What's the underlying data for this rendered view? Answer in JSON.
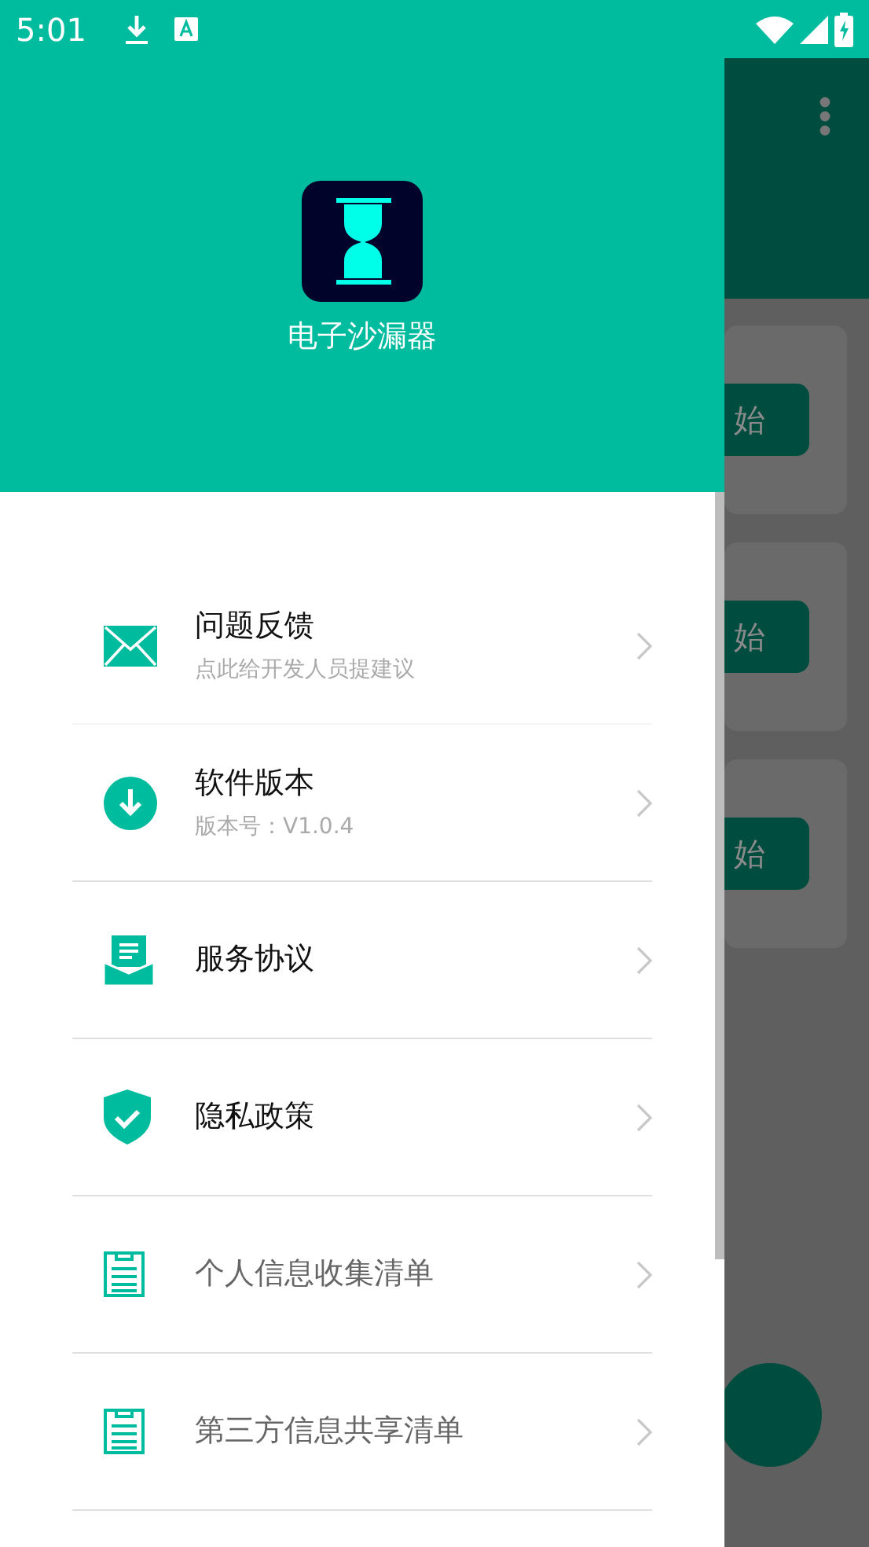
{
  "status_bar": {
    "time": "5:01"
  },
  "header": {
    "app_name": "电子沙漏器"
  },
  "menu": [
    {
      "kind": "info",
      "title": "问题反馈",
      "subtitle": "点此给开发人员提建议"
    },
    {
      "kind": "info",
      "title": "软件版本",
      "subtitle": "版本号：V1.0.4"
    },
    {
      "kind": "info",
      "title": "服务协议"
    },
    {
      "kind": "info",
      "title": "隐私政策"
    },
    {
      "kind": "list",
      "title": "个人信息收集清单"
    },
    {
      "kind": "list",
      "title": "第三方信息共享清单"
    }
  ],
  "background": {
    "buttons": [
      "始",
      "始",
      "始"
    ]
  }
}
